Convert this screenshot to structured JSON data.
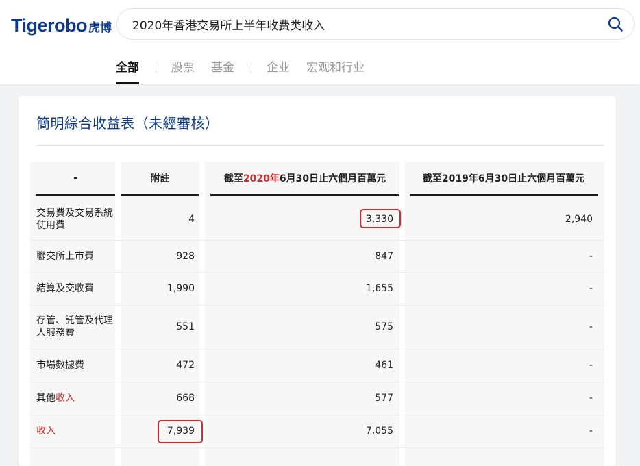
{
  "brand": {
    "latin": "Tigerobo",
    "cjk": "虎博"
  },
  "search": {
    "query": "2020年香港交易所上半年收费类收入"
  },
  "tabs": [
    {
      "label": "全部",
      "active": true
    },
    {
      "label": "股票"
    },
    {
      "label": "基金"
    },
    {
      "label": "企业"
    },
    {
      "label": "宏观和行业"
    }
  ],
  "card": {
    "title": "簡明綜合收益表（未經審核）"
  },
  "table": {
    "headers": {
      "item": "-",
      "note": "附註",
      "col2020_prefix": "截至",
      "col2020_year": "2020年",
      "col2020_suffix": "6月30日止六個月百萬元",
      "col2019": "截至2019年6月30日止六個月百萬元"
    },
    "rows": [
      {
        "label": "交易費及交易系統使用費",
        "note": "4",
        "v2020": "3,330",
        "v2019": "2,940"
      },
      {
        "label": "聯交所上市費",
        "note": "928",
        "v2020": "847",
        "v2019": "-"
      },
      {
        "label": "結算及交收費",
        "note": "1,990",
        "v2020": "1,655",
        "v2019": "-"
      },
      {
        "label": "存管、託管及代理人服務費",
        "note": "551",
        "v2020": "575",
        "v2019": "-"
      },
      {
        "label": "市場數據費",
        "note": "472",
        "v2020": "461",
        "v2019": "-"
      },
      {
        "label_prefix": "其他",
        "label_hl": "收入",
        "note": "668",
        "v2020": "577",
        "v2019": "-"
      },
      {
        "label_hl": "收入",
        "note": "7,939",
        "v2020": "7,055",
        "v2019": "-"
      }
    ]
  },
  "colors": {
    "brand": "#0d3a8c",
    "highlight": "#d62b2b"
  }
}
